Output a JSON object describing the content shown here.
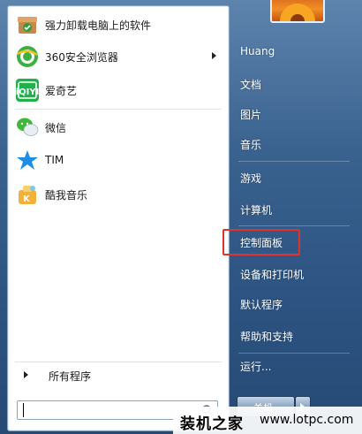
{
  "programs": [
    {
      "label": "强力卸载电脑上的软件",
      "icon": "uninstall-box-icon",
      "has_submenu": false
    },
    {
      "label": "360安全浏览器",
      "icon": "360-browser-icon",
      "has_submenu": true
    },
    {
      "label": "爱奇艺",
      "icon": "iqiyi-icon",
      "has_submenu": false
    },
    {
      "label": "微信",
      "icon": "wechat-icon",
      "has_submenu": false
    },
    {
      "label": "TIM",
      "icon": "tim-icon",
      "has_submenu": false
    },
    {
      "label": "酷我音乐",
      "icon": "kuwo-music-icon",
      "has_submenu": false
    }
  ],
  "all_programs_label": "所有程序",
  "search": {
    "value": "",
    "placeholder": ""
  },
  "right_items": [
    {
      "label": "Huang"
    },
    {
      "label": "文档"
    },
    {
      "label": "图片"
    },
    {
      "label": "音乐"
    },
    {
      "label": "游戏"
    },
    {
      "label": "计算机"
    },
    {
      "label": "控制面板"
    },
    {
      "label": "设备和打印机"
    },
    {
      "label": "默认程序"
    },
    {
      "label": "帮助和支持"
    },
    {
      "label": "运行..."
    }
  ],
  "shutdown_label": "关机",
  "highlighted_item": "控制面板",
  "highlight_color": "#e0332d",
  "watermark": {
    "brand": "装机之家",
    "url": "www.lotpc.com"
  }
}
